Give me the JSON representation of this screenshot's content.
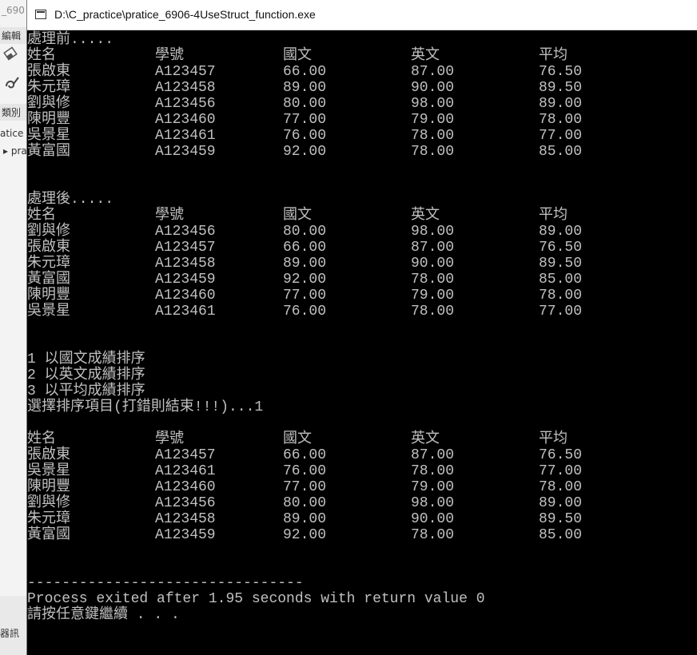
{
  "background_ide": {
    "fragments": [
      "_690",
      "編輯",
      "類別",
      "atice",
      "▸ pra",
      "器訊"
    ]
  },
  "window": {
    "title": "D:\\C_practice\\pratice_6906-4UseStruct_function.exe"
  },
  "console": {
    "before_label": "處理前.....",
    "headers": [
      "姓名",
      "學號",
      "國文",
      "英文",
      "平均"
    ],
    "before_rows": [
      [
        "張啟東",
        "A123457",
        "66.00",
        "87.00",
        "76.50"
      ],
      [
        "朱元璋",
        "A123458",
        "89.00",
        "90.00",
        "89.50"
      ],
      [
        "劉與修",
        "A123456",
        "80.00",
        "98.00",
        "89.00"
      ],
      [
        "陳明豐",
        "A123460",
        "77.00",
        "79.00",
        "78.00"
      ],
      [
        "吳景星",
        "A123461",
        "76.00",
        "78.00",
        "77.00"
      ],
      [
        "黃富國",
        "A123459",
        "92.00",
        "78.00",
        "85.00"
      ]
    ],
    "after_label": "處理後.....",
    "after_rows": [
      [
        "劉與修",
        "A123456",
        "80.00",
        "98.00",
        "89.00"
      ],
      [
        "張啟東",
        "A123457",
        "66.00",
        "87.00",
        "76.50"
      ],
      [
        "朱元璋",
        "A123458",
        "89.00",
        "90.00",
        "89.50"
      ],
      [
        "黃富國",
        "A123459",
        "92.00",
        "78.00",
        "85.00"
      ],
      [
        "陳明豐",
        "A123460",
        "77.00",
        "79.00",
        "78.00"
      ],
      [
        "吳景星",
        "A123461",
        "76.00",
        "78.00",
        "77.00"
      ]
    ],
    "menu": [
      "1 以國文成績排序",
      "2 以英文成績排序",
      "3 以平均成績排序"
    ],
    "prompt": "選擇排序項目(打錯則結束!!!)...1",
    "sorted_rows": [
      [
        "張啟東",
        "A123457",
        "66.00",
        "87.00",
        "76.50"
      ],
      [
        "吳景星",
        "A123461",
        "76.00",
        "78.00",
        "77.00"
      ],
      [
        "陳明豐",
        "A123460",
        "77.00",
        "79.00",
        "78.00"
      ],
      [
        "劉與修",
        "A123456",
        "80.00",
        "98.00",
        "89.00"
      ],
      [
        "朱元璋",
        "A123458",
        "89.00",
        "90.00",
        "89.50"
      ],
      [
        "黃富國",
        "A123459",
        "92.00",
        "78.00",
        "85.00"
      ]
    ],
    "separator": "--------------------------------",
    "exit_message": "Process exited after 1.95 seconds with return value 0",
    "press_any_key": "請按任意鍵繼續 . . ."
  }
}
